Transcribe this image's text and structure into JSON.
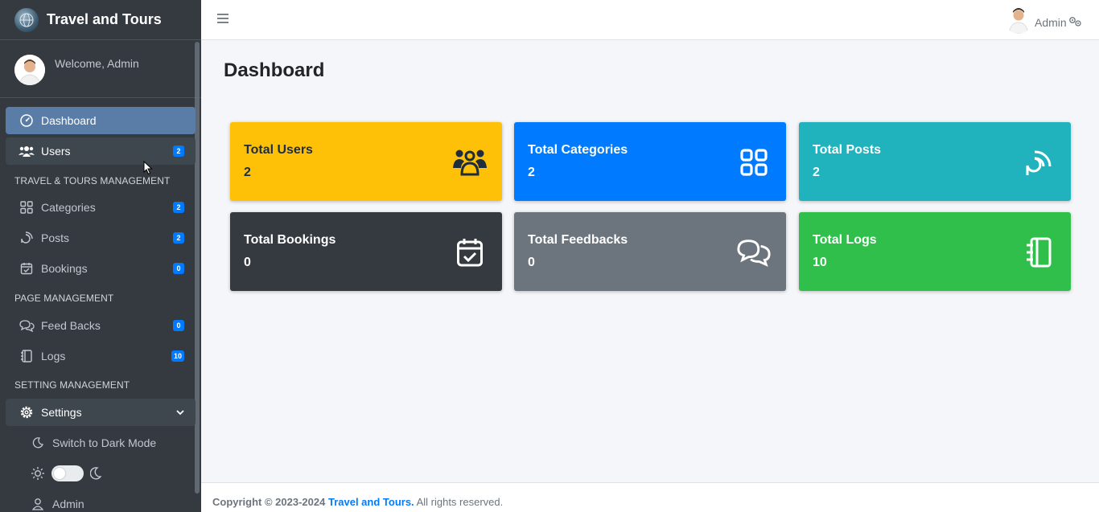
{
  "brand": {
    "title": "Travel and Tours"
  },
  "user_panel": {
    "welcome": "Welcome, Admin"
  },
  "topbar": {
    "user": "Admin"
  },
  "sidebar": {
    "items": [
      {
        "label": "Dashboard",
        "icon": "dashboard-icon"
      },
      {
        "label": "Users",
        "icon": "users-icon",
        "badge": "2"
      },
      {
        "label": "Categories",
        "icon": "grid-icon",
        "badge": "2"
      },
      {
        "label": "Posts",
        "icon": "rss-icon",
        "badge": "2"
      },
      {
        "label": "Bookings",
        "icon": "calendar-check-icon",
        "badge": "0"
      },
      {
        "label": "Feed Backs",
        "icon": "chat-icon",
        "badge": "0"
      },
      {
        "label": "Logs",
        "icon": "journal-icon",
        "badge": "10"
      },
      {
        "label": "Settings",
        "icon": "gear-icon"
      },
      {
        "label": "Switch to Dark Mode",
        "icon": "moon-icon"
      },
      {
        "label": "Admin",
        "icon": "person-icon"
      }
    ],
    "headers": {
      "travel": "TRAVEL & TOURS MANAGEMENT",
      "page": "PAGE MANAGEMENT",
      "setting": "SETTING MANAGEMENT"
    }
  },
  "main": {
    "title": "Dashboard",
    "cards": [
      {
        "title": "Total Users",
        "value": "2",
        "color": "#ffc107",
        "icon": "users-icon"
      },
      {
        "title": "Total Categories",
        "value": "2",
        "color": "#007bff",
        "icon": "grid-icon"
      },
      {
        "title": "Total Posts",
        "value": "2",
        "color": "#17a2b8",
        "icon": "rss-icon"
      },
      {
        "title": "Total Bookings",
        "value": "0",
        "color": "#343a40",
        "icon": "calendar-check-icon"
      },
      {
        "title": "Total Feedbacks",
        "value": "0",
        "color": "#6c757d",
        "icon": "chat-icon"
      },
      {
        "title": "Total Logs",
        "value": "10",
        "color": "#28a745",
        "icon": "journal-icon"
      }
    ]
  },
  "footer": {
    "prefix": "Copyright © 2023-2024",
    "link": "Travel and Tours.",
    "suffix": "All rights reserved."
  }
}
